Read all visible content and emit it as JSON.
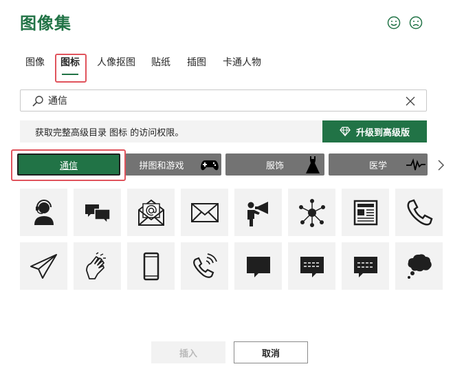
{
  "window": {
    "title": "图像集"
  },
  "feedback": {
    "positive_icon": "smile-icon",
    "negative_icon": "frown-icon"
  },
  "tabs": [
    {
      "label": "图像",
      "active": false
    },
    {
      "label": "图标",
      "active": true
    },
    {
      "label": "人像抠图",
      "active": false
    },
    {
      "label": "贴纸",
      "active": false
    },
    {
      "label": "插图",
      "active": false
    },
    {
      "label": "卡通人物",
      "active": false
    }
  ],
  "search": {
    "value": "通信",
    "placeholder": ""
  },
  "banner": {
    "message": "获取完整高级目录 图标 的访问权限。",
    "upgrade_label": "升级到高级版"
  },
  "categories": [
    {
      "label": "通信",
      "active": true
    },
    {
      "label": "拼图和游戏",
      "icon": "gamepad-icon"
    },
    {
      "label": "服饰",
      "icon": "dress-icon"
    },
    {
      "label": "医学",
      "icon": "heartbeat-icon"
    }
  ],
  "icons": [
    "headset-user-icon",
    "chat-bubbles-icon",
    "email-at-icon",
    "envelope-icon",
    "megaphone-person-icon",
    "network-hub-icon",
    "newspaper-icon",
    "phone-icon",
    "paper-plane-icon",
    "sign-language-icon",
    "smartphone-icon",
    "phone-ringing-icon",
    "speech-bubble-icon",
    "text-bubble-icon",
    "message-bubble-icon",
    "thought-bubble-icon"
  ],
  "footer": {
    "insert_label": "插入",
    "cancel_label": "取消"
  },
  "colors": {
    "accent": "#217346",
    "highlight": "#e0535c",
    "category": "#737373"
  }
}
